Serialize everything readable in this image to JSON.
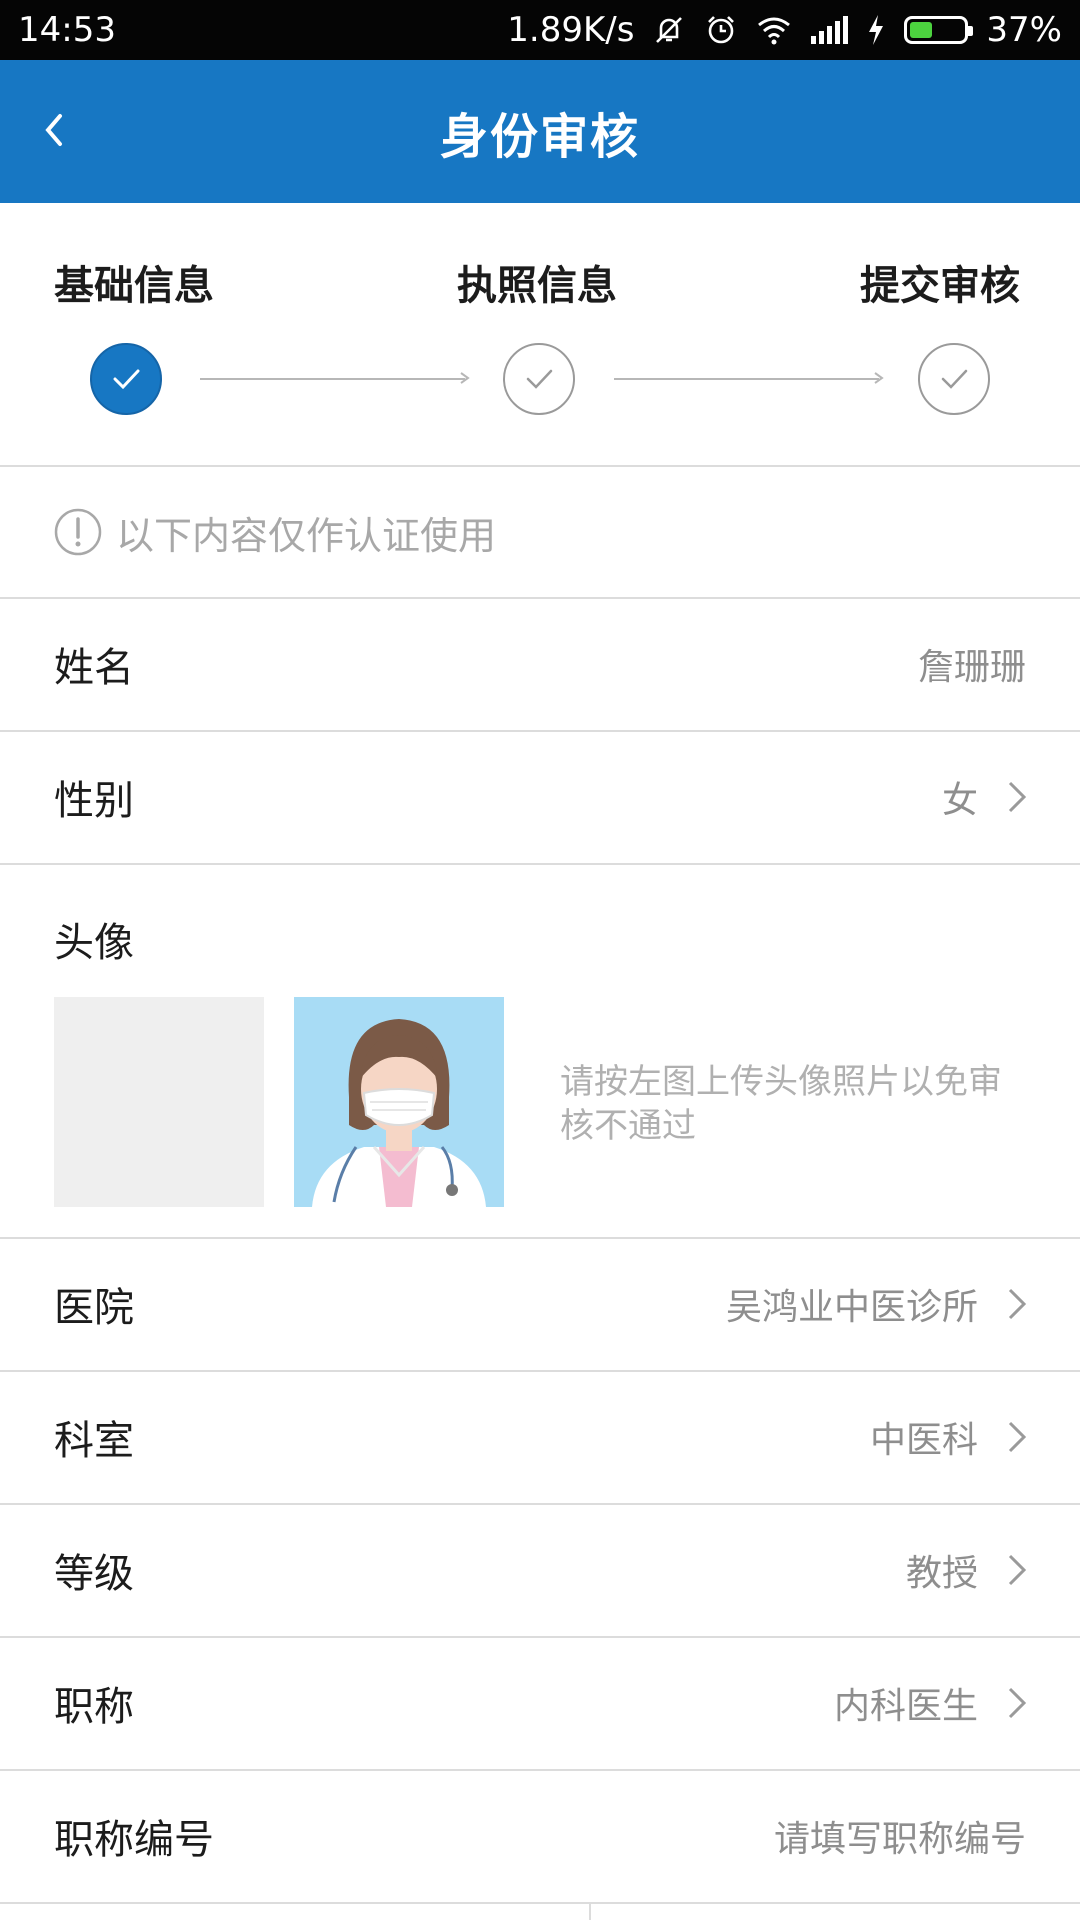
{
  "status_bar": {
    "time": "14:53",
    "net_speed": "1.89K/s",
    "battery": "37%",
    "icons": [
      "mute-icon",
      "alarm-icon",
      "wifi-icon",
      "signal-icon",
      "charging-icon",
      "battery-icon"
    ]
  },
  "app_bar": {
    "title": "身份审核"
  },
  "steps": [
    {
      "label": "基础信息",
      "completed": true
    },
    {
      "label": "执照信息",
      "completed": false
    },
    {
      "label": "提交审核",
      "completed": false
    }
  ],
  "notice": {
    "text": "以下内容仅作认证使用"
  },
  "form": {
    "name": {
      "label": "姓名",
      "value": "詹珊珊"
    },
    "gender": {
      "label": "性别",
      "value": "女"
    },
    "avatar": {
      "label": "头像",
      "hint": "请按左图上传头像照片以免审核不通过"
    },
    "hospital": {
      "label": "医院",
      "value": "吴鸿业中医诊所"
    },
    "department": {
      "label": "科室",
      "value": "中医科"
    },
    "level": {
      "label": "等级",
      "value": "教授"
    },
    "title": {
      "label": "职称",
      "value": "内科医生"
    },
    "title_number": {
      "label": "职称编号",
      "placeholder": "请填写职称编号"
    }
  },
  "colors": {
    "primary": "#1777c3",
    "status_bar": "#050505",
    "divider": "#dcdcdc",
    "hint_text": "#a8a8a8"
  }
}
